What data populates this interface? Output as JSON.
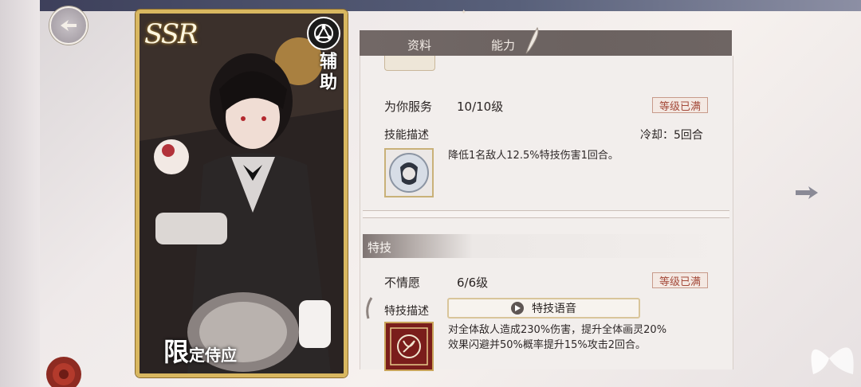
{
  "card": {
    "rarity": "SSR",
    "role": "辅助",
    "limit_big": "限",
    "limit_small": "定侍应"
  },
  "tabs": [
    {
      "label": "资料"
    },
    {
      "label": "能力"
    }
  ],
  "skill": {
    "name": "为你服务",
    "level": "10/10级",
    "maxed": "等级已满",
    "desc_label": "技能描述",
    "cooldown": "冷却：5回合",
    "description": "降低1名敌人12.5%特技伤害1回合。"
  },
  "special": {
    "section_label": "特技",
    "name": "不情愿",
    "level": "6/6级",
    "maxed": "等级已满",
    "desc_label": "特技描述",
    "voice_label": "特技语音",
    "description_line1": "对全体敌人造成230%伤害，提升全体画灵20%",
    "description_line2": "效果闪避并50%概率提升15%攻击2回合。"
  },
  "colors": {
    "accent_gold": "#d8b760",
    "tab_bar": "#6b6260",
    "maxed_text": "#a44a3a"
  }
}
